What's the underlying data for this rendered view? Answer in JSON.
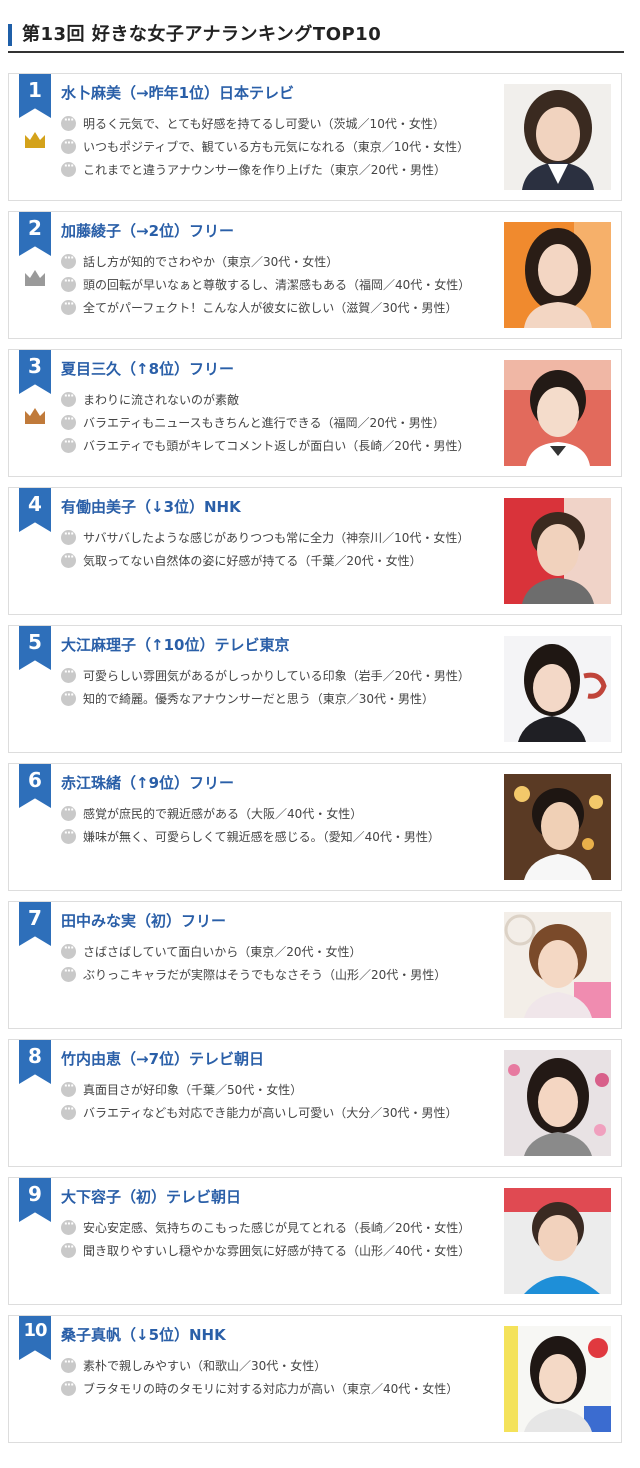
{
  "header": {
    "title": "第13回 好きな女子アナランキングTOP10"
  },
  "ranking": [
    {
      "rank": "1",
      "name": "水卜麻美（→昨年1位）日本テレビ",
      "comments": [
        "明るく元気で、とても好感を持てるし可愛い（茨城／10代・女性）",
        "いつもポジティブで、観ている方も元気になれる（東京／10代・女性）",
        "これまでと違うアナウンサー像を作り上げた（東京／20代・男性）"
      ]
    },
    {
      "rank": "2",
      "name": "加藤綾子（→2位）フリー",
      "comments": [
        "話し方が知的でさわやか（東京／30代・女性）",
        "頭の回転が早いなぁと尊敬するし、清潔感もある（福岡／40代・女性）",
        "全てがパーフェクト！こんな人が彼女に欲しい（滋賀／30代・男性）"
      ]
    },
    {
      "rank": "3",
      "name": "夏目三久（↑8位）フリー",
      "comments": [
        "まわりに流されないのが素敵",
        "バラエティもニュースもきちんと進行できる（福岡／20代・男性）",
        "バラエティでも頭がキレてコメント返しが面白い（長崎／20代・男性）"
      ]
    },
    {
      "rank": "4",
      "name": "有働由美子（↓3位）NHK",
      "comments": [
        "サバサバしたような感じがありつつも常に全力（神奈川／10代・女性）",
        "気取ってない自然体の姿に好感が持てる（千葉／20代・女性）"
      ]
    },
    {
      "rank": "5",
      "name": "大江麻理子（↑10位）テレビ東京",
      "comments": [
        "可愛らしい雰囲気があるがしっかりしている印象（岩手／20代・男性）",
        "知的で綺麗。優秀なアナウンサーだと思う（東京／30代・男性）"
      ]
    },
    {
      "rank": "6",
      "name": "赤江珠緒（↑9位）フリー",
      "comments": [
        "感覚が庶民的で親近感がある（大阪／40代・女性）",
        "嫌味が無く、可愛らしくて親近感を感じる。（愛知／40代・男性）"
      ]
    },
    {
      "rank": "7",
      "name": "田中みな実（初）フリー",
      "comments": [
        "さばさばしていて面白いから（東京／20代・女性）",
        "ぶりっこキャラだが実際はそうでもなさそう（山形／20代・男性）"
      ]
    },
    {
      "rank": "8",
      "name": "竹内由恵（→7位）テレビ朝日",
      "comments": [
        "真面目さが好印象（千葉／50代・女性）",
        "バラエティなども対応でき能力が高いし可愛い（大分／30代・男性）"
      ]
    },
    {
      "rank": "9",
      "name": "大下容子（初）テレビ朝日",
      "comments": [
        "安心安定感、気持ちのこもった感じが見てとれる（長崎／20代・女性）",
        "聞き取りやすいし穏やかな雰囲気に好感が持てる（山形／40代・女性）"
      ]
    },
    {
      "rank": "10",
      "name": "桑子真帆（↓5位）NHK",
      "comments": [
        "素朴で親しみやすい（和歌山／30代・女性）",
        "ブラタモリの時のタモリに対する対応力が高い（東京／40代・女性）"
      ]
    }
  ],
  "crowns": [
    "gold-crown-icon",
    "silver-crown-icon",
    "bronze-crown-icon"
  ],
  "colors": {
    "accent": "#2e6fba",
    "name_text": "#2a5fa8",
    "gold": "#d4a21a",
    "silver": "#9a9a9a",
    "bronze": "#c07a3a"
  }
}
